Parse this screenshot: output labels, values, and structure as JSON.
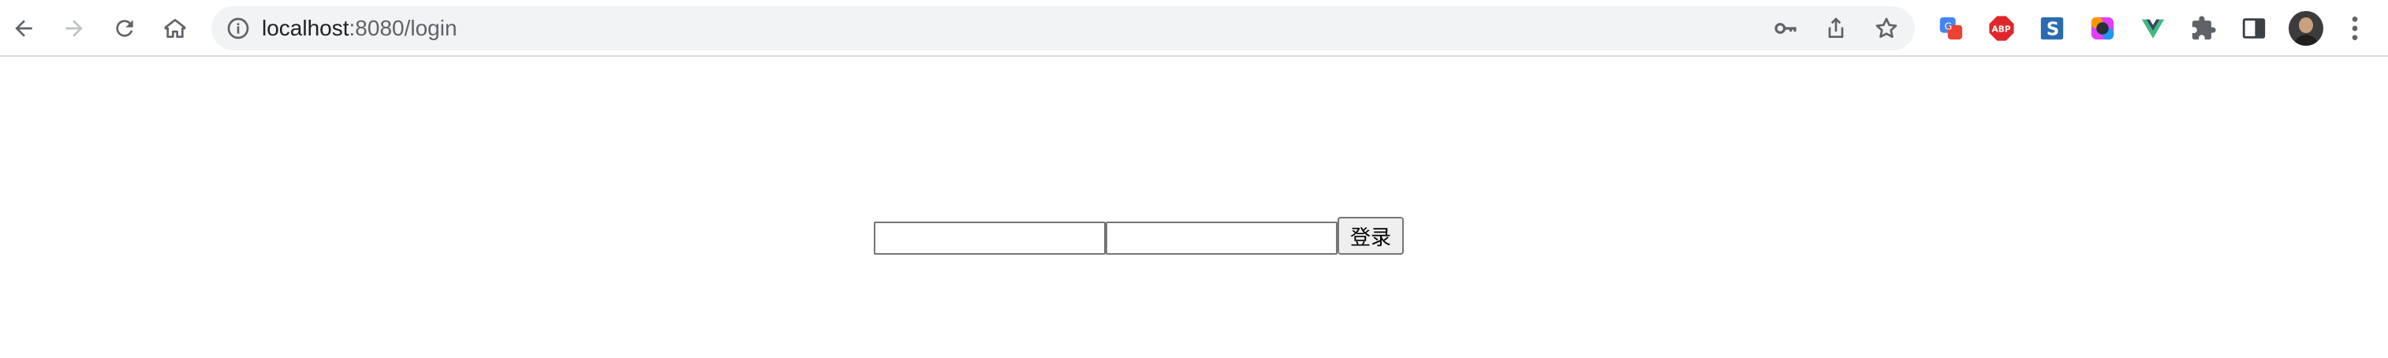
{
  "browser": {
    "url_host": "localhost",
    "url_path": ":8080/login",
    "icons": {
      "back": "back-arrow-icon",
      "forward": "forward-arrow-icon",
      "reload": "reload-icon",
      "home": "home-icon",
      "site_info": "info-icon",
      "password_key": "key-icon",
      "share": "share-icon",
      "bookmark": "star-icon",
      "extensions": [
        "google-translate-extension-icon",
        "adblock-plus-icon",
        "s-extension-icon",
        "color-picker-extension-icon",
        "vue-devtools-icon",
        "puzzle-extensions-icon"
      ],
      "side_panel": "side-panel-icon",
      "profile": "avatar",
      "menu": "kebab-menu-icon"
    }
  },
  "login_form": {
    "username_value": "",
    "password_value": "",
    "submit_label": "登录"
  },
  "colors": {
    "toolbar_bg": "#ffffff",
    "omnibox_bg": "#f1f3f4",
    "button_bg": "#efefef",
    "input_border": "#767676"
  }
}
